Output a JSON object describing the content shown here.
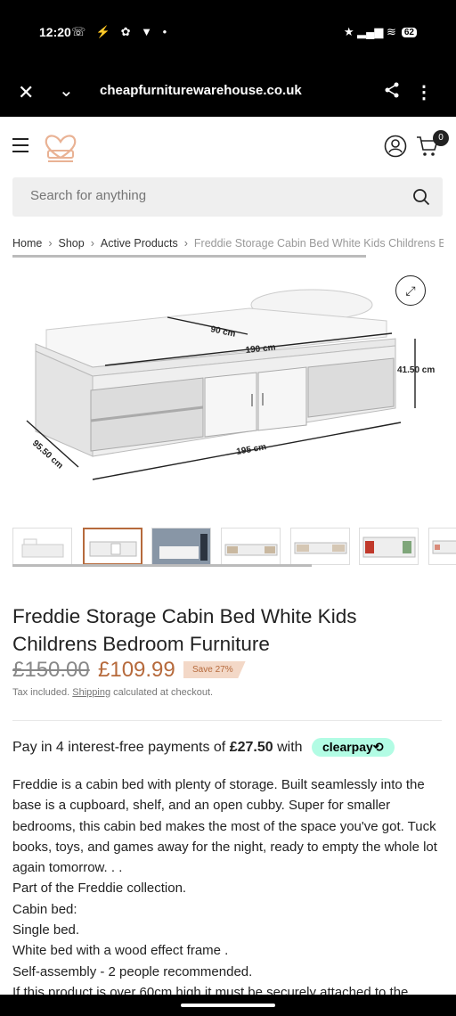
{
  "status_bar": {
    "time": "12:20",
    "notification_icons": "☏ ⚡ ✿ ▼ •",
    "signal_icons": "★ ▂▄▆ ≋",
    "battery": "62"
  },
  "browser": {
    "url": "cheapfurniturewarehouse.co.uk",
    "close_icon": "close-icon",
    "menu_icon": "kebab-icon"
  },
  "header": {
    "cart_count": "0"
  },
  "search": {
    "placeholder": "Search for anything"
  },
  "breadcrumb": {
    "items": [
      "Home",
      "Shop",
      "Active Products"
    ],
    "current": "Freddie Storage Cabin Bed White Kids Childrens Bedroom Furniture"
  },
  "image_labels": {
    "depth": "90 cm",
    "inner_length": "190 cm",
    "height": "41.50 cm",
    "width": "95.50 cm",
    "length": "195 cm"
  },
  "product": {
    "title": "Freddie Storage Cabin Bed White Kids Childrens Bedroom Furniture",
    "price_old": "£150.00",
    "price_new": "£109.99",
    "save_badge": "Save 27%",
    "tax_prefix": "Tax included.",
    "tax_link": "Shipping",
    "tax_suffix": "calculated at checkout."
  },
  "payment": {
    "prefix": "Pay in 4 interest-free payments of",
    "amount": "£27.50",
    "suffix": "with",
    "provider": "clearpay⟲"
  },
  "description": [
    "Freddie is a cabin bed with plenty of storage. Built seamlessly into the base is a cupboard, shelf, and an open cubby. Super for smaller bedrooms, this cabin bed makes the most of the space you've got. Tuck books, toys, and games away for the night, ready to empty the whole lot again tomorrow. . .",
    "Part of the Freddie collection.",
    "Cabin bed:",
    "Single bed.",
    "White bed with a wood effect frame .",
    "Self-assembly - 2 people recommended.",
    "If this product is over 60cm high it must be securely attached to the"
  ],
  "colors": {
    "accent": "#b66a3c",
    "save_bg": "#f3d8c7",
    "clearpay": "#b2fce4"
  }
}
